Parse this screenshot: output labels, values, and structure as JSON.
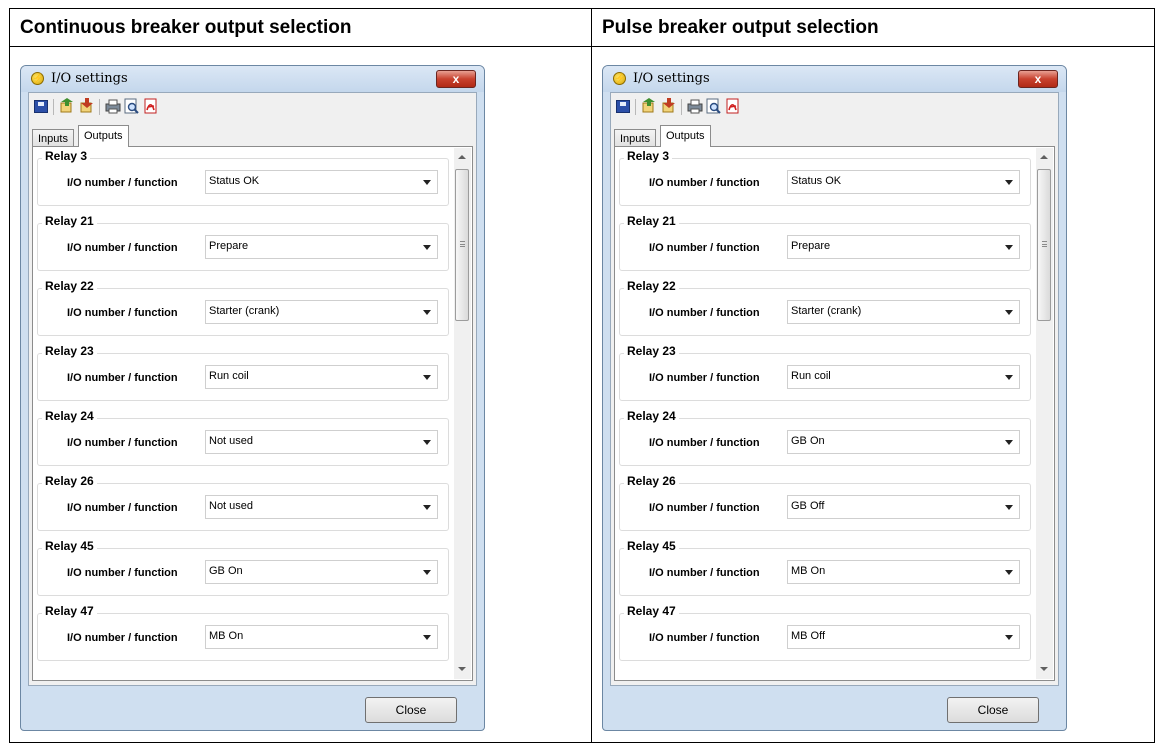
{
  "columns": [
    {
      "title": "Continuous breaker output selection",
      "window": {
        "title": "I/O settings",
        "close_glyph": "x",
        "tabs": [
          "Inputs",
          "Outputs"
        ],
        "active_tab": "Outputs",
        "close_button": "Close",
        "relays": [
          {
            "name": "Relay 3",
            "label": "I/O number / function",
            "value": "Status OK"
          },
          {
            "name": "Relay 21",
            "label": "I/O number / function",
            "value": "Prepare"
          },
          {
            "name": "Relay 22",
            "label": "I/O number / function",
            "value": "Starter (crank)"
          },
          {
            "name": "Relay 23",
            "label": "I/O number / function",
            "value": "Run coil"
          },
          {
            "name": "Relay 24",
            "label": "I/O number / function",
            "value": "Not used"
          },
          {
            "name": "Relay 26",
            "label": "I/O number / function",
            "value": "Not used"
          },
          {
            "name": "Relay 45",
            "label": "I/O number / function",
            "value": "GB On"
          },
          {
            "name": "Relay 47",
            "label": "I/O number / function",
            "value": "MB On"
          }
        ]
      }
    },
    {
      "title": "Pulse breaker output selection",
      "window": {
        "title": "I/O settings",
        "close_glyph": "x",
        "tabs": [
          "Inputs",
          "Outputs"
        ],
        "active_tab": "Outputs",
        "close_button": "Close",
        "relays": [
          {
            "name": "Relay 3",
            "label": "I/O number / function",
            "value": "Status OK"
          },
          {
            "name": "Relay 21",
            "label": "I/O number / function",
            "value": "Prepare"
          },
          {
            "name": "Relay 22",
            "label": "I/O number / function",
            "value": "Starter (crank)"
          },
          {
            "name": "Relay 23",
            "label": "I/O number / function",
            "value": "Run coil"
          },
          {
            "name": "Relay 24",
            "label": "I/O number / function",
            "value": "GB On"
          },
          {
            "name": "Relay 26",
            "label": "I/O number / function",
            "value": "GB Off"
          },
          {
            "name": "Relay 45",
            "label": "I/O number / function",
            "value": "MB On"
          },
          {
            "name": "Relay 47",
            "label": "I/O number / function",
            "value": "MB Off"
          }
        ]
      }
    }
  ],
  "toolbar_icons": [
    "save-icon",
    "import-icon",
    "export-icon",
    "print-icon",
    "print-preview-icon",
    "pdf-icon"
  ],
  "colors": {
    "title_close": "#c8412e",
    "window_frame": "#cfdff0"
  }
}
